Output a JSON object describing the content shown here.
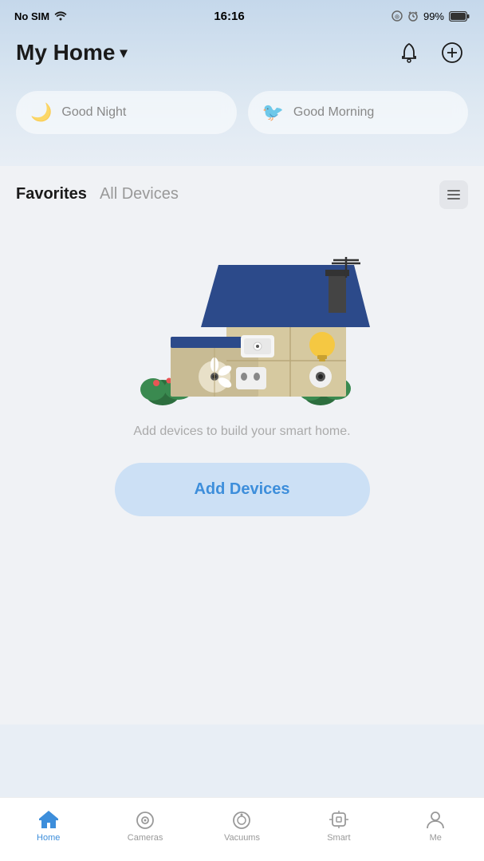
{
  "statusBar": {
    "carrier": "No SIM",
    "time": "16:16",
    "battery": "99%"
  },
  "header": {
    "title": "My Home",
    "chevron": "▼"
  },
  "scenes": [
    {
      "id": "good-night",
      "label": "Good Night",
      "icon": "🌙"
    },
    {
      "id": "good-morning",
      "label": "Good Morning",
      "icon": "🐦"
    }
  ],
  "tabs": [
    {
      "id": "favorites",
      "label": "Favorites",
      "active": true
    },
    {
      "id": "all-devices",
      "label": "All Devices",
      "active": false
    }
  ],
  "emptyState": {
    "text": "Add devices to build your smart home."
  },
  "addDevicesButton": {
    "label": "Add Devices"
  },
  "bottomNav": [
    {
      "id": "home",
      "label": "Home",
      "active": true
    },
    {
      "id": "cameras",
      "label": "Cameras",
      "active": false
    },
    {
      "id": "vacuums",
      "label": "Vacuums",
      "active": false
    },
    {
      "id": "smart",
      "label": "Smart",
      "active": false
    },
    {
      "id": "me",
      "label": "Me",
      "active": false
    }
  ]
}
